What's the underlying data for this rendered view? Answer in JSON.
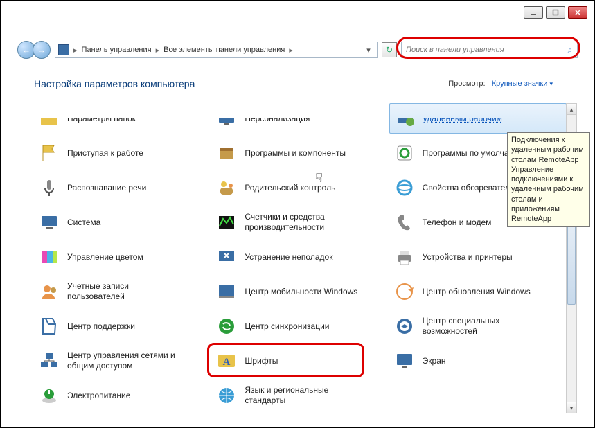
{
  "window": {
    "minimize_icon": "_",
    "maximize_icon": "▢",
    "close_icon": "✕"
  },
  "nav": {
    "back_icon": "←",
    "forward_icon": "→",
    "cp_label": "",
    "crumb1": "Панель управления",
    "crumb2": "Все элементы панели управления",
    "sep": "▸",
    "dropdown": "▾",
    "refresh": "↻"
  },
  "search": {
    "placeholder": "Поиск в панели управления",
    "icon": "⌕"
  },
  "header": {
    "title": "Настройка параметров компьютера",
    "view_label": "Просмотр:",
    "view_value": "Крупные значки",
    "view_dd": "▾"
  },
  "items": [
    {
      "label": "Параметры папок",
      "icon": "folder",
      "half": true
    },
    {
      "label": "Персонализация",
      "icon": "monitor",
      "half": true
    },
    {
      "label": "удаленным рабочим",
      "icon": "remote",
      "selected": true,
      "half": true
    },
    {
      "label": "Приступая к работе",
      "icon": "flag"
    },
    {
      "label": "Программы и компоненты",
      "icon": "box"
    },
    {
      "label": "Программы по умолчанию",
      "icon": "defaults"
    },
    {
      "label": "Распознавание речи",
      "icon": "mic"
    },
    {
      "label": "Родительский контроль",
      "icon": "family"
    },
    {
      "label": "Свойства обозревателя",
      "icon": "ieopts"
    },
    {
      "label": "Система",
      "icon": "system"
    },
    {
      "label": "Счетчики и средства производительности",
      "icon": "perf"
    },
    {
      "label": "Телефон и модем",
      "icon": "phone"
    },
    {
      "label": "Управление цветом",
      "icon": "color"
    },
    {
      "label": "Устранение неполадок",
      "icon": "trouble"
    },
    {
      "label": "Устройства и принтеры",
      "icon": "printer"
    },
    {
      "label": "Учетные записи пользователей",
      "icon": "users"
    },
    {
      "label": "Центр мобильности Windows",
      "icon": "mobility"
    },
    {
      "label": "Центр обновления Windows",
      "icon": "update"
    },
    {
      "label": "Центр поддержки",
      "icon": "action"
    },
    {
      "label": "Центр синхронизации",
      "icon": "sync"
    },
    {
      "label": "Центр специальных возможностей",
      "icon": "ease"
    },
    {
      "label": "Центр управления сетями и общим доступом",
      "icon": "network"
    },
    {
      "label": "Шрифты",
      "icon": "fonts",
      "highlight": true
    },
    {
      "label": "Экран",
      "icon": "display"
    },
    {
      "label": "Электропитание",
      "icon": "power"
    },
    {
      "label": "Язык и региональные стандарты",
      "icon": "region"
    }
  ],
  "tooltip": {
    "text": "Подключения к удаленным\nрабочим столам\nRemoteApp\nУправление подключениями к\nудаленным рабочим столам и\nприложениям RemoteApp"
  },
  "icons": {
    "folder": "#e8c34a",
    "monitor": "#3a6ea5",
    "remote": "#3a6ea5",
    "flag": "#e8c34a",
    "box": "#c59a4a",
    "defaults": "#2a9d3a",
    "mic": "#888",
    "family": "#e8c34a",
    "ieopts": "#3a9dd5",
    "system": "#3a6ea5",
    "perf": "#2a7d2a",
    "phone": "#888",
    "color": "#e84ab5",
    "trouble": "#3a6ea5",
    "printer": "#888",
    "users": "#e8944a",
    "mobility": "#3a6ea5",
    "update": "#e8944a",
    "action": "#3a6ea5",
    "sync": "#2a9d3a",
    "ease": "#3a6ea5",
    "network": "#3a6ea5",
    "fonts": "#e8c34a",
    "display": "#3a6ea5",
    "power": "#2a9d3a",
    "region": "#3a9dd5"
  }
}
